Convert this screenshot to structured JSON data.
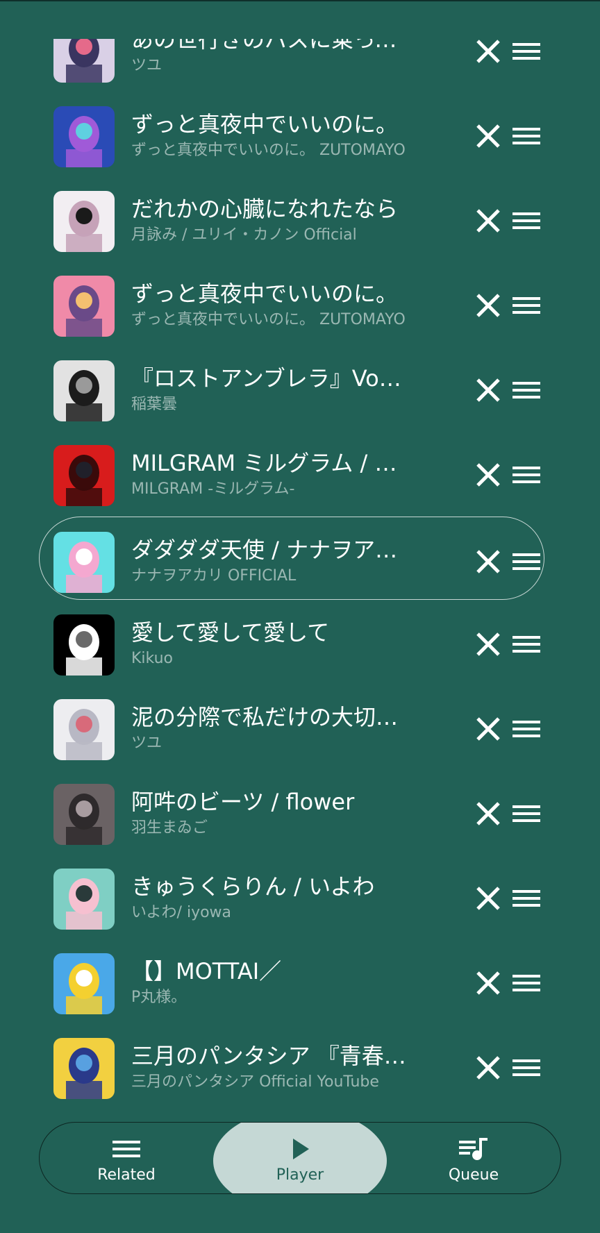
{
  "queue": [
    {
      "title": "あの世行きのバスに乗ってさらば。",
      "artist": "ツユ",
      "thumb_colors": [
        "#d9d0e6",
        "#3a3560",
        "#e56a8a"
      ]
    },
    {
      "title": "ずっと真夜中でいいのに。",
      "artist": "ずっと真夜中でいいのに。 ZUTOMAYO",
      "thumb_colors": [
        "#2a4bb6",
        "#a05ad8",
        "#5fd0e0"
      ]
    },
    {
      "title": "だれかの心臓になれたなら",
      "artist": "月詠み / ユリイ・カノン Official",
      "thumb_colors": [
        "#f2eef2",
        "#c6a2b8",
        "#1a1a1a"
      ]
    },
    {
      "title": "ずっと真夜中でいいのに。",
      "artist": "ずっと真夜中でいいのに。 ZUTOMAYO",
      "thumb_colors": [
        "#f08aa8",
        "#6a4a88",
        "#f4c070"
      ]
    },
    {
      "title": "『ロストアンブレラ』Vocaloid",
      "artist": "稲葉曇",
      "thumb_colors": [
        "#e2e2e2",
        "#1c1c1c",
        "#9a9a9a"
      ]
    },
    {
      "title": "MILGRAM ミルグラム / アイ",
      "artist": "MILGRAM -ミルグラム-",
      "thumb_colors": [
        "#d81c1c",
        "#3a0a0a",
        "#20202a"
      ]
    },
    {
      "title": "ダダダダ天使 / ナナヲアカリ",
      "artist": "ナナヲアカリ OFFICIAL",
      "thumb_colors": [
        "#64e0e4",
        "#f4a8d0",
        "#ffffff"
      ],
      "current": true
    },
    {
      "title": "愛して愛して愛して",
      "artist": "Kikuo",
      "thumb_colors": [
        "#000000",
        "#ffffff",
        "#6a6a6a"
      ]
    },
    {
      "title": "泥の分際で私だけの大切を奪おうだなんて",
      "artist": "ツユ",
      "thumb_colors": [
        "#ededf0",
        "#b8b8c4",
        "#d86a7a"
      ]
    },
    {
      "title": "阿吽のビーツ / flower",
      "artist": "羽生まゐご",
      "thumb_colors": [
        "#6a6264",
        "#2e2a2c",
        "#a89ca0"
      ]
    },
    {
      "title": "きゅうくらりん / いよわ",
      "artist": "いよわ/ iyowa",
      "thumb_colors": [
        "#7fcfc4",
        "#f6c0d0",
        "#2a3a3a"
      ]
    },
    {
      "title": "【】MOTTAI／",
      "artist": "P丸様。",
      "thumb_colors": [
        "#4aa8e8",
        "#f4d030",
        "#ffffff"
      ]
    },
    {
      "title": "三月のパンタシア 『青春なんていらないわ』",
      "artist": "三月のパンタシア Official YouTube",
      "thumb_colors": [
        "#f2d040",
        "#2a3a8a",
        "#58a0e0"
      ]
    }
  ],
  "nav": {
    "related": "Related",
    "player": "Player",
    "queue": "Queue",
    "active": "player"
  },
  "colors": {
    "background": "#216156",
    "active_pill": "#c5d8d5"
  },
  "icons": {
    "remove": "close-icon",
    "drag": "drag-handle-icon",
    "related": "menu-lines-icon",
    "player": "play-icon",
    "queue": "queue-music-icon"
  }
}
